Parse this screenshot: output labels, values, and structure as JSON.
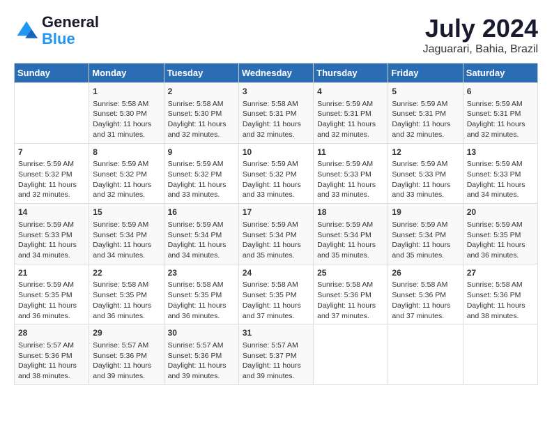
{
  "logo": {
    "line1": "General",
    "line2": "Blue"
  },
  "title": "July 2024",
  "location": "Jaguarari, Bahia, Brazil",
  "headers": [
    "Sunday",
    "Monday",
    "Tuesday",
    "Wednesday",
    "Thursday",
    "Friday",
    "Saturday"
  ],
  "weeks": [
    [
      {
        "day": "",
        "sunrise": "",
        "sunset": "",
        "daylight": ""
      },
      {
        "day": "1",
        "sunrise": "Sunrise: 5:58 AM",
        "sunset": "Sunset: 5:30 PM",
        "daylight": "Daylight: 11 hours and 31 minutes."
      },
      {
        "day": "2",
        "sunrise": "Sunrise: 5:58 AM",
        "sunset": "Sunset: 5:30 PM",
        "daylight": "Daylight: 11 hours and 32 minutes."
      },
      {
        "day": "3",
        "sunrise": "Sunrise: 5:58 AM",
        "sunset": "Sunset: 5:31 PM",
        "daylight": "Daylight: 11 hours and 32 minutes."
      },
      {
        "day": "4",
        "sunrise": "Sunrise: 5:59 AM",
        "sunset": "Sunset: 5:31 PM",
        "daylight": "Daylight: 11 hours and 32 minutes."
      },
      {
        "day": "5",
        "sunrise": "Sunrise: 5:59 AM",
        "sunset": "Sunset: 5:31 PM",
        "daylight": "Daylight: 11 hours and 32 minutes."
      },
      {
        "day": "6",
        "sunrise": "Sunrise: 5:59 AM",
        "sunset": "Sunset: 5:31 PM",
        "daylight": "Daylight: 11 hours and 32 minutes."
      }
    ],
    [
      {
        "day": "7",
        "sunrise": "Sunrise: 5:59 AM",
        "sunset": "Sunset: 5:32 PM",
        "daylight": "Daylight: 11 hours and 32 minutes."
      },
      {
        "day": "8",
        "sunrise": "Sunrise: 5:59 AM",
        "sunset": "Sunset: 5:32 PM",
        "daylight": "Daylight: 11 hours and 32 minutes."
      },
      {
        "day": "9",
        "sunrise": "Sunrise: 5:59 AM",
        "sunset": "Sunset: 5:32 PM",
        "daylight": "Daylight: 11 hours and 33 minutes."
      },
      {
        "day": "10",
        "sunrise": "Sunrise: 5:59 AM",
        "sunset": "Sunset: 5:32 PM",
        "daylight": "Daylight: 11 hours and 33 minutes."
      },
      {
        "day": "11",
        "sunrise": "Sunrise: 5:59 AM",
        "sunset": "Sunset: 5:33 PM",
        "daylight": "Daylight: 11 hours and 33 minutes."
      },
      {
        "day": "12",
        "sunrise": "Sunrise: 5:59 AM",
        "sunset": "Sunset: 5:33 PM",
        "daylight": "Daylight: 11 hours and 33 minutes."
      },
      {
        "day": "13",
        "sunrise": "Sunrise: 5:59 AM",
        "sunset": "Sunset: 5:33 PM",
        "daylight": "Daylight: 11 hours and 34 minutes."
      }
    ],
    [
      {
        "day": "14",
        "sunrise": "Sunrise: 5:59 AM",
        "sunset": "Sunset: 5:33 PM",
        "daylight": "Daylight: 11 hours and 34 minutes."
      },
      {
        "day": "15",
        "sunrise": "Sunrise: 5:59 AM",
        "sunset": "Sunset: 5:34 PM",
        "daylight": "Daylight: 11 hours and 34 minutes."
      },
      {
        "day": "16",
        "sunrise": "Sunrise: 5:59 AM",
        "sunset": "Sunset: 5:34 PM",
        "daylight": "Daylight: 11 hours and 34 minutes."
      },
      {
        "day": "17",
        "sunrise": "Sunrise: 5:59 AM",
        "sunset": "Sunset: 5:34 PM",
        "daylight": "Daylight: 11 hours and 35 minutes."
      },
      {
        "day": "18",
        "sunrise": "Sunrise: 5:59 AM",
        "sunset": "Sunset: 5:34 PM",
        "daylight": "Daylight: 11 hours and 35 minutes."
      },
      {
        "day": "19",
        "sunrise": "Sunrise: 5:59 AM",
        "sunset": "Sunset: 5:34 PM",
        "daylight": "Daylight: 11 hours and 35 minutes."
      },
      {
        "day": "20",
        "sunrise": "Sunrise: 5:59 AM",
        "sunset": "Sunset: 5:35 PM",
        "daylight": "Daylight: 11 hours and 36 minutes."
      }
    ],
    [
      {
        "day": "21",
        "sunrise": "Sunrise: 5:59 AM",
        "sunset": "Sunset: 5:35 PM",
        "daylight": "Daylight: 11 hours and 36 minutes."
      },
      {
        "day": "22",
        "sunrise": "Sunrise: 5:58 AM",
        "sunset": "Sunset: 5:35 PM",
        "daylight": "Daylight: 11 hours and 36 minutes."
      },
      {
        "day": "23",
        "sunrise": "Sunrise: 5:58 AM",
        "sunset": "Sunset: 5:35 PM",
        "daylight": "Daylight: 11 hours and 36 minutes."
      },
      {
        "day": "24",
        "sunrise": "Sunrise: 5:58 AM",
        "sunset": "Sunset: 5:35 PM",
        "daylight": "Daylight: 11 hours and 37 minutes."
      },
      {
        "day": "25",
        "sunrise": "Sunrise: 5:58 AM",
        "sunset": "Sunset: 5:36 PM",
        "daylight": "Daylight: 11 hours and 37 minutes."
      },
      {
        "day": "26",
        "sunrise": "Sunrise: 5:58 AM",
        "sunset": "Sunset: 5:36 PM",
        "daylight": "Daylight: 11 hours and 37 minutes."
      },
      {
        "day": "27",
        "sunrise": "Sunrise: 5:58 AM",
        "sunset": "Sunset: 5:36 PM",
        "daylight": "Daylight: 11 hours and 38 minutes."
      }
    ],
    [
      {
        "day": "28",
        "sunrise": "Sunrise: 5:57 AM",
        "sunset": "Sunset: 5:36 PM",
        "daylight": "Daylight: 11 hours and 38 minutes."
      },
      {
        "day": "29",
        "sunrise": "Sunrise: 5:57 AM",
        "sunset": "Sunset: 5:36 PM",
        "daylight": "Daylight: 11 hours and 39 minutes."
      },
      {
        "day": "30",
        "sunrise": "Sunrise: 5:57 AM",
        "sunset": "Sunset: 5:36 PM",
        "daylight": "Daylight: 11 hours and 39 minutes."
      },
      {
        "day": "31",
        "sunrise": "Sunrise: 5:57 AM",
        "sunset": "Sunset: 5:37 PM",
        "daylight": "Daylight: 11 hours and 39 minutes."
      },
      {
        "day": "",
        "sunrise": "",
        "sunset": "",
        "daylight": ""
      },
      {
        "day": "",
        "sunrise": "",
        "sunset": "",
        "daylight": ""
      },
      {
        "day": "",
        "sunrise": "",
        "sunset": "",
        "daylight": ""
      }
    ]
  ]
}
